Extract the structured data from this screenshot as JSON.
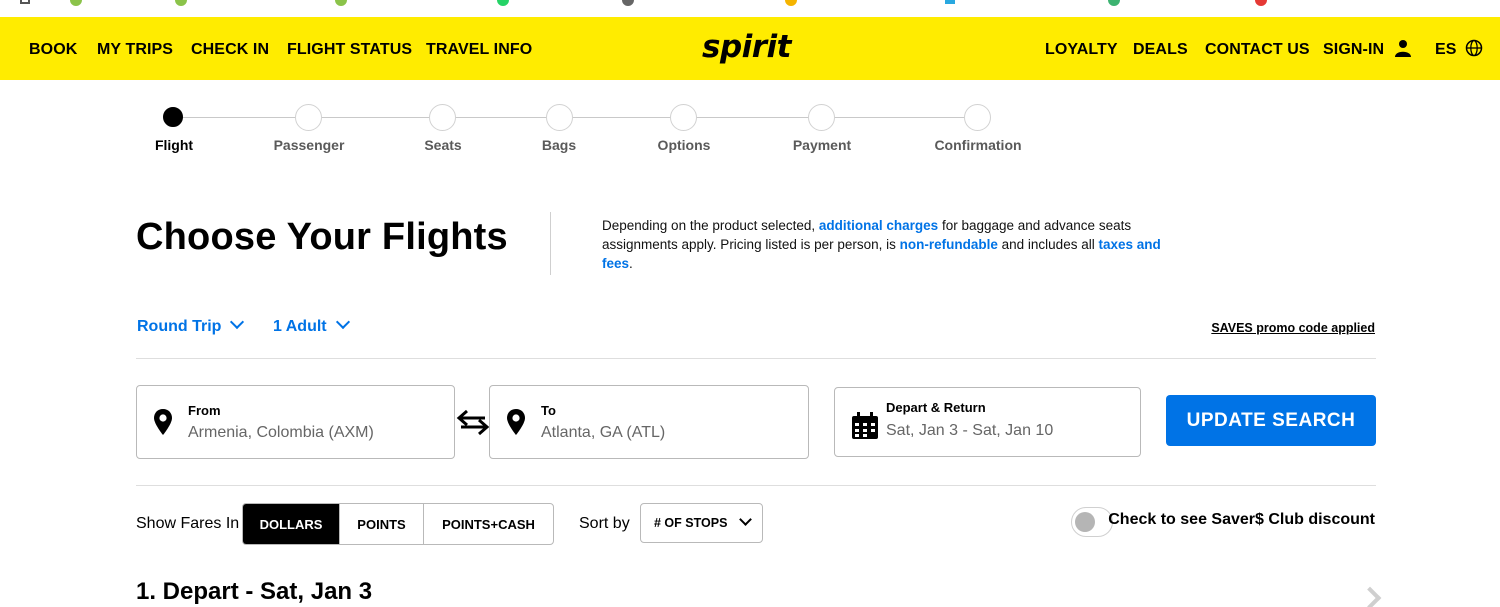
{
  "nav": {
    "left": [
      "BOOK",
      "MY TRIPS",
      "CHECK IN",
      "FLIGHT STATUS",
      "TRAVEL INFO"
    ],
    "logo": "spirit",
    "right": [
      "LOYALTY",
      "DEALS",
      "CONTACT US",
      "SIGN-IN",
      "ES"
    ]
  },
  "steps": [
    "Flight",
    "Passenger",
    "Seats",
    "Bags",
    "Options",
    "Payment",
    "Confirmation"
  ],
  "heading": {
    "title": "Choose Your Flights",
    "info_1": "Depending on the product selected, ",
    "info_link_1": "additional charges",
    "info_2": " for baggage and advance seats assignments apply. Pricing listed is per person, is ",
    "info_link_2": "non-refundable",
    "info_3": " and includes all ",
    "info_link_3": "taxes and fees",
    "info_4": "."
  },
  "trip": {
    "type": "Round Trip",
    "passengers": "1 Adult",
    "promo": "SAVES promo code applied"
  },
  "search": {
    "from_label": "From",
    "from_value": "Armenia, Colombia (AXM)",
    "to_label": "To",
    "to_value": "Atlanta, GA (ATL)",
    "dates_label": "Depart & Return",
    "dates_value": "Sat, Jan 3 - Sat, Jan 10",
    "button": "UPDATE SEARCH"
  },
  "fares": {
    "label": "Show Fares In",
    "options": [
      "DOLLARS",
      "POINTS",
      "POINTS+CASH"
    ],
    "sort_label": "Sort by",
    "sort_value": "# OF STOPS",
    "club_label": "Check to see Saver$ Club discount"
  },
  "depart": {
    "title": "1. Depart - Sat, Jan 3"
  },
  "colors": {
    "brand_yellow": "#ffec00",
    "link_blue": "#0073e6"
  }
}
